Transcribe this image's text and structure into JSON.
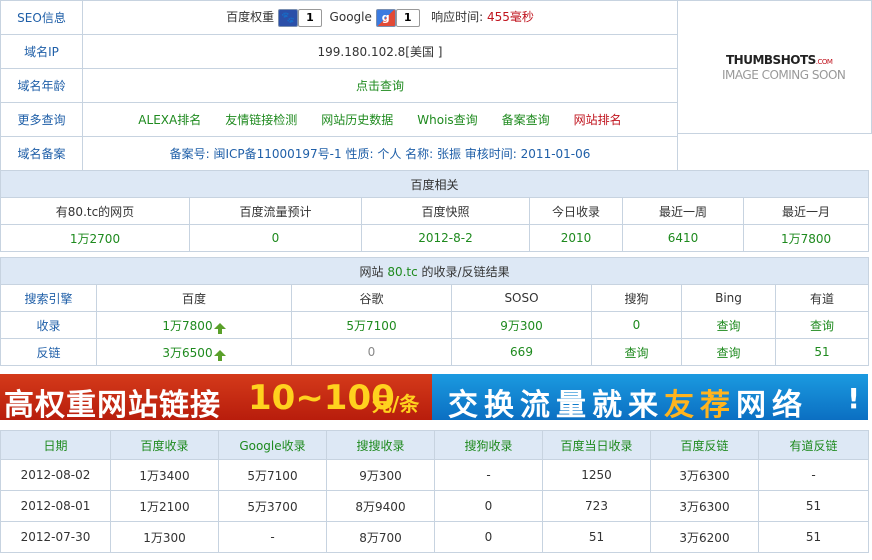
{
  "info": {
    "seo_label": "SEO信息",
    "baidu_weight_label": "百度权重",
    "baidu_pr": "1",
    "google_label": "Google",
    "google_pr": "1",
    "response_label": "响应时间:",
    "response_value": "455毫秒",
    "ip_label": "域名IP",
    "ip_value": "199.180.102.8[美国 ]",
    "age_label": "域名年龄",
    "age_value": "点击查询",
    "more_label": "更多查询",
    "more_links": [
      "ALEXA排名",
      "友情链接检测",
      "网站历史数据",
      "Whois查询",
      "备案查询",
      "网站排名"
    ],
    "beian_label": "域名备案",
    "beian_value": "备案号: 闽ICP备11000197号-1  性质: 个人  名称: 张振  审核时间: 2011-01-06"
  },
  "thumb": {
    "brand": "THUMBSHOTS",
    "suffix": ".COM",
    "coming": "IMAGE COMING SOON"
  },
  "baidu": {
    "title": "百度相关",
    "headers": [
      "有80.tc的网页",
      "百度流量预计",
      "百度快照",
      "今日收录",
      "最近一周",
      "最近一月"
    ],
    "values": [
      "1万2700",
      "0",
      "2012-8-2",
      "2010",
      "6410",
      "1万7800"
    ]
  },
  "links": {
    "title_prefix": "网站",
    "title_domain": "80.tc",
    "title_suffix": "的收录/反链结果",
    "headers": [
      "搜索引擎",
      "百度",
      "谷歌",
      "SOSO",
      "搜狗",
      "Bing",
      "有道"
    ],
    "row1": [
      "收录",
      "1万7800",
      "5万7100",
      "9万300",
      "0",
      "查询",
      "查询"
    ],
    "row2": [
      "反链",
      "3万6500",
      "0",
      "669",
      "查询",
      "查询",
      "51"
    ]
  },
  "banner": {
    "left_text": "高权重网站链接",
    "left_num": "10~100",
    "left_unit": "元/条",
    "right_text_a": "交换流量就来",
    "right_text_b": "友荐",
    "right_text_c": "网络",
    "right_mark": "!"
  },
  "history": {
    "headers": [
      "日期",
      "百度收录",
      "Google收录",
      "搜搜收录",
      "搜狗收录",
      "百度当日收录",
      "百度反链",
      "有道反链"
    ],
    "rows": [
      [
        "2012-08-02",
        "1万3400",
        "5万7100",
        "9万300",
        "-",
        "1250",
        "3万6300",
        "-"
      ],
      [
        "2012-08-01",
        "1万2100",
        "5万3700",
        "8万9400",
        "0",
        "723",
        "3万6300",
        "51"
      ],
      [
        "2012-07-30",
        "1万300",
        "-",
        "8万700",
        "0",
        "51",
        "3万6200",
        "51"
      ]
    ]
  }
}
